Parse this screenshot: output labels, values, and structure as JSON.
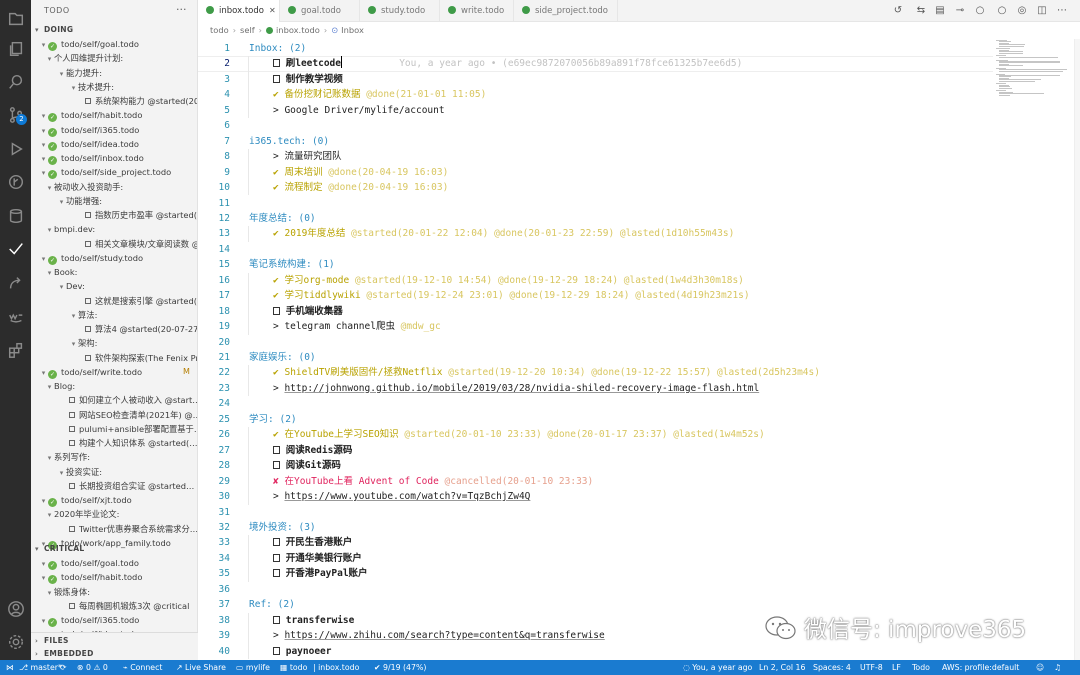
{
  "sidebar": {
    "title": "TODO",
    "more": "···",
    "sections": {
      "doing": "DOING",
      "critical": "CRITICAL",
      "files": "FILES",
      "embedded": "EMBEDDED"
    },
    "rows": [
      {
        "text": "todo/self/goal.todo",
        "kind": "file"
      },
      {
        "text": "个人四维提升计划:",
        "kind": "group"
      },
      {
        "text": "能力提升:",
        "kind": "group"
      },
      {
        "text": "技术提升:",
        "kind": "group"
      },
      {
        "text": "系统架构能力 @started(20…",
        "kind": "item"
      },
      {
        "text": "todo/self/habit.todo",
        "kind": "file"
      },
      {
        "text": "todo/self/i365.todo",
        "kind": "file"
      },
      {
        "text": "todo/self/idea.todo",
        "kind": "file"
      },
      {
        "text": "todo/self/inbox.todo",
        "kind": "file"
      },
      {
        "text": "todo/self/side_project.todo",
        "kind": "file"
      },
      {
        "text": "被动收入投资助手:",
        "kind": "group"
      },
      {
        "text": "功能增强:",
        "kind": "group"
      },
      {
        "text": "指数历史市盈率 @started(2…",
        "kind": "item"
      },
      {
        "text": "bmpi.dev:",
        "kind": "group"
      },
      {
        "text": "相关文章模块/文章阅读数 @st…",
        "kind": "item"
      },
      {
        "text": "todo/self/study.todo",
        "kind": "file"
      },
      {
        "text": "Book:",
        "kind": "group"
      },
      {
        "text": "Dev:",
        "kind": "group"
      },
      {
        "text": "这就是搜索引擎 @started(2…",
        "kind": "item"
      },
      {
        "text": "算法:",
        "kind": "group"
      },
      {
        "text": "算法4 @started(20-07-27…",
        "kind": "item"
      },
      {
        "text": "架构:",
        "kind": "group"
      },
      {
        "text": "软件架构探索(The Fenix Pr…",
        "kind": "item"
      },
      {
        "text": "todo/self/write.todo",
        "kind": "file",
        "badge": "M"
      },
      {
        "text": "Blog:",
        "kind": "group"
      },
      {
        "text": "如何建立个人被动收入 @start…",
        "kind": "item"
      },
      {
        "text": "网站SEO检查清单(2021年) @…",
        "kind": "item"
      },
      {
        "text": "pulumi+ansible部署配置基于…",
        "kind": "item"
      },
      {
        "text": "构建个人知识体系 @started(…",
        "kind": "item"
      },
      {
        "text": "系列写作:",
        "kind": "group"
      },
      {
        "text": "投资实证:",
        "kind": "group"
      },
      {
        "text": "长期投资组合实证 @started…",
        "kind": "item"
      },
      {
        "text": "todo/self/xjt.todo",
        "kind": "file"
      },
      {
        "text": "2020年毕业论文:",
        "kind": "group"
      },
      {
        "text": "Twitter优惠券聚合系统需求分…",
        "kind": "item"
      },
      {
        "text": "todo/work/app_family.todo",
        "kind": "file"
      }
    ],
    "critical_rows": [
      {
        "text": "todo/self/goal.todo",
        "kind": "file"
      },
      {
        "text": "todo/self/habit.todo",
        "kind": "file"
      },
      {
        "text": "锻炼身体:",
        "kind": "group"
      },
      {
        "text": "每周椭圆机锻炼3次 @critical",
        "kind": "item"
      },
      {
        "text": "todo/self/i365.todo",
        "kind": "file"
      },
      {
        "text": "todo/self/idea.todo",
        "kind": "file"
      }
    ]
  },
  "tabs": [
    {
      "label": "inbox.todo",
      "active": true
    },
    {
      "label": "goal.todo"
    },
    {
      "label": "study.todo"
    },
    {
      "label": "write.todo"
    },
    {
      "label": "side_project.todo"
    }
  ],
  "breadcrumb": [
    "todo",
    "self",
    "inbox.todo",
    "Inbox"
  ],
  "editor": {
    "blame": "You, a year ago • (e69ec9872070056b89a891f78fce61325b7ee6d5)",
    "lines": [
      {
        "n": "1",
        "t": "Inbox: (2)"
      },
      {
        "n": "2",
        "t": "☐ 刷leetcode"
      },
      {
        "n": "3",
        "t": "☐ 制作教学视频"
      },
      {
        "n": "4",
        "t": "✔ 备份挖财记账数据 @done(21-01-01 11:05)"
      },
      {
        "n": "5",
        "t": "> Google Driver/mylife/account"
      },
      {
        "n": "6",
        "t": ""
      },
      {
        "n": "7",
        "t": "i365.tech: (0)"
      },
      {
        "n": "8",
        "t": "> 流量研究团队"
      },
      {
        "n": "9",
        "t": "✔ 周末培训 @done(20-04-19 16:03)"
      },
      {
        "n": "10",
        "t": "✔ 流程制定 @done(20-04-19 16:03)"
      },
      {
        "n": "11",
        "t": ""
      },
      {
        "n": "12",
        "t": "年度总结: (0)"
      },
      {
        "n": "13",
        "t": "✔ 2019年度总结 @started(20-01-22 12:04) @done(20-01-23 22:59) @lasted(1d10h55m43s)"
      },
      {
        "n": "14",
        "t": ""
      },
      {
        "n": "15",
        "t": "笔记系统构建: (1)"
      },
      {
        "n": "16",
        "t": "✔ 学习org-mode @started(19-12-10 14:54) @done(19-12-29 18:24) @lasted(1w4d3h30m18s)"
      },
      {
        "n": "17",
        "t": "✔ 学习tiddlywiki @started(19-12-24 23:01) @done(19-12-29 18:24) @lasted(4d19h23m21s)"
      },
      {
        "n": "18",
        "t": "☐ 手机端收集器"
      },
      {
        "n": "19",
        "t": "> telegram channel爬虫 @mdw_gc"
      },
      {
        "n": "20",
        "t": ""
      },
      {
        "n": "21",
        "t": "家庭娱乐: (0)"
      },
      {
        "n": "22",
        "t": "✔ ShieldTV刷美版固件/拯救Netflix @started(19-12-20 10:34) @done(19-12-22 15:57) @lasted(2d5h23m4s)"
      },
      {
        "n": "23",
        "t": "> http://johnwong.github.io/mobile/2019/03/28/nvidia-shiled-recovery-image-flash.html"
      },
      {
        "n": "24",
        "t": ""
      },
      {
        "n": "25",
        "t": "学习: (2)"
      },
      {
        "n": "26",
        "t": "✔ 在YouTube上学习SEO知识 @started(20-01-10 23:33) @done(20-01-17 23:37) @lasted(1w4m52s)"
      },
      {
        "n": "27",
        "t": "☐ 阅读Redis源码"
      },
      {
        "n": "28",
        "t": "☐ 阅读Git源码"
      },
      {
        "n": "29",
        "t": "✘ 在YouTube上看 Advent of Code @cancelled(20-01-10 23:33)"
      },
      {
        "n": "30",
        "t": "> https://www.youtube.com/watch?v=TqzBchjZw4Q"
      },
      {
        "n": "31",
        "t": ""
      },
      {
        "n": "32",
        "t": "境外投资: (3)"
      },
      {
        "n": "33",
        "t": "☐ 开民生香港账户"
      },
      {
        "n": "34",
        "t": "☐ 开通华美银行账户"
      },
      {
        "n": "35",
        "t": "☐ 开香港PayPal账户"
      },
      {
        "n": "36",
        "t": ""
      },
      {
        "n": "37",
        "t": "Ref: (2)"
      },
      {
        "n": "38",
        "t": "☐ transferwise"
      },
      {
        "n": "39",
        "t": "> https://www.zhihu.com/search?type=content&q=transferwise"
      },
      {
        "n": "40",
        "t": "☐ paynoeer"
      }
    ]
  },
  "watermark": "微信号: improve365",
  "status": {
    "branch": "master*",
    "errors": "⊗ 0 ⚠ 0",
    "connect": "Connect",
    "live_share": "Live Share",
    "mylife": "mylife",
    "todo": "todo",
    "inbox": "inbox.todo",
    "progress": "9/19 (47%)",
    "blame": "You, a year ago",
    "position": "Ln 2, Col 16",
    "spaces": "Spaces: 4",
    "encoding": "UTF-8",
    "eol": "LF",
    "lang": "Todo",
    "aws": "AWS: profile:default"
  },
  "colors": {
    "status_bg": "#1a7bd0",
    "activity_bg": "#2c2c2c",
    "project": "#2e8bc0",
    "done": "#b8a200",
    "cancel": "#e0245e",
    "file_ok": "#6ab24a"
  }
}
